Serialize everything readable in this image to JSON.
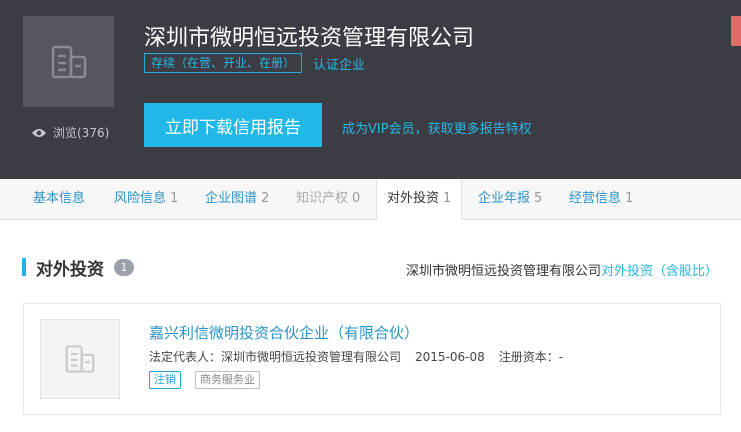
{
  "header": {
    "company_name": "深圳市微明恒远投资管理有限公司",
    "status": "存续（在营、开业、在册）",
    "verified": "认证企业",
    "views": "浏览(376)",
    "download_button": "立即下载信用报告",
    "vip_link": "成为VIP会员，获取更多报告特权"
  },
  "tabs": [
    {
      "label": "基本信息",
      "count": ""
    },
    {
      "label": "风险信息",
      "count": "1"
    },
    {
      "label": "企业图谱",
      "count": "2"
    },
    {
      "label": "知识产权",
      "count": "0"
    },
    {
      "label": "对外投资",
      "count": "1"
    },
    {
      "label": "企业年报",
      "count": "5"
    },
    {
      "label": "经营信息",
      "count": "1"
    }
  ],
  "active_tab": "对外投资",
  "section": {
    "title": "对外投资",
    "count": "1",
    "right_company": "深圳市微明恒远投资管理有限公司",
    "right_link": "对外投资（含股比）"
  },
  "investments": [
    {
      "name": "嘉兴利信微明投资合伙企业（有限合伙）",
      "legal_rep_label": "法定代表人：",
      "legal_rep": "深圳市微明恒远投资管理有限公司",
      "date": "2015-06-08",
      "capital_label": "注册资本：",
      "capital": "-",
      "status_tag": "注销",
      "industry_tag": "商务服务业"
    }
  ],
  "colors": {
    "header_bg": "#3b3c44",
    "accent": "#21b7e8",
    "link": "#2a94c8"
  },
  "icons": [
    "eye-icon",
    "building-placeholder-icon"
  ]
}
